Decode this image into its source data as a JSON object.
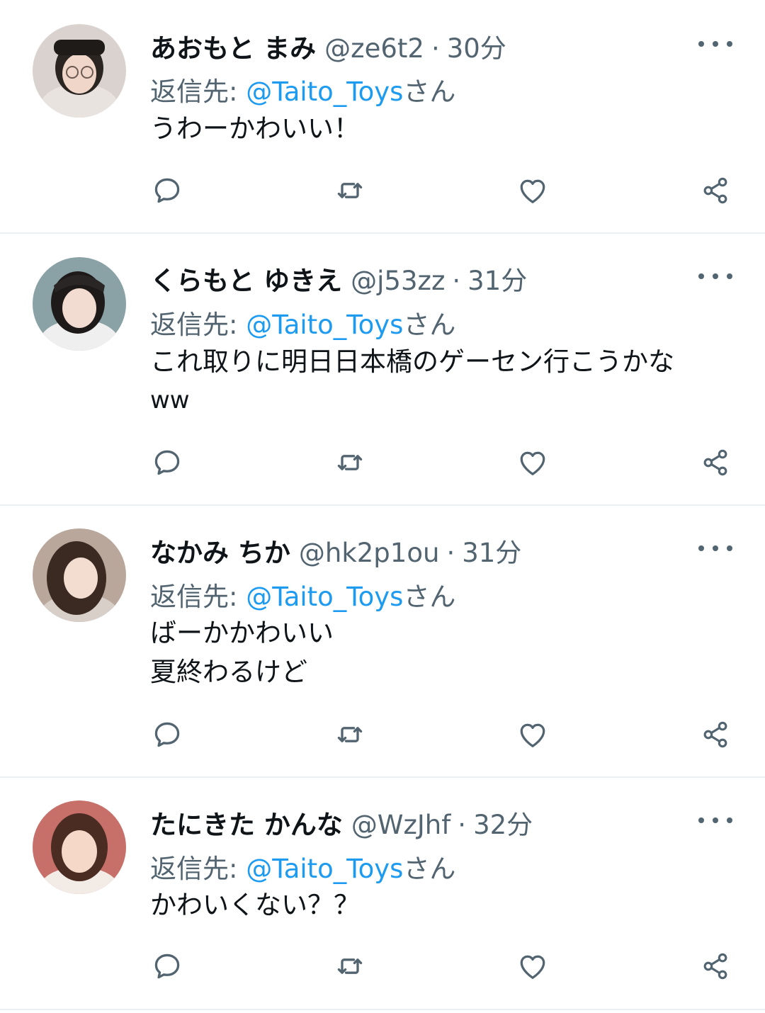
{
  "reply_prefix": "返信先: ",
  "reply_suffix": "さん",
  "separator": "·",
  "tweets": [
    {
      "name": "あおもと まみ",
      "handle": "@ze6t2",
      "time": "30分",
      "mention": "@Taito_Toys",
      "lines": [
        "うわーかわいい！"
      ],
      "avatar": {
        "bg": "#d9d2cf",
        "hair": "#2b2522",
        "skin": "#f0d6c8",
        "cloth": "#e9e3e0"
      }
    },
    {
      "name": "くらもと ゆきえ",
      "handle": "@j53zz",
      "time": "31分",
      "mention": "@Taito_Toys",
      "lines": [
        "これ取りに明日日本橋のゲーセン行こうかな",
        "ww"
      ],
      "avatar": {
        "bg": "#8aa2a6",
        "hair": "#1e1a19",
        "skin": "#f2dbd0",
        "cloth": "#efefef"
      }
    },
    {
      "name": "なかみ ちか",
      "handle": "@hk2p1ou",
      "time": "31分",
      "mention": "@Taito_Toys",
      "lines": [
        "ばーかかわいい",
        "夏終わるけど"
      ],
      "avatar": {
        "bg": "#b9a79c",
        "hair": "#3a2a22",
        "skin": "#f3dcd0",
        "cloth": "#d8cfc8"
      }
    },
    {
      "name": "たにきた かんな",
      "handle": "@WzJhf",
      "time": "32分",
      "mention": "@Taito_Toys",
      "lines": [
        "かわいくない？？"
      ],
      "avatar": {
        "bg": "#c7706a",
        "hair": "#4a2c22",
        "skin": "#f5d8c8",
        "cloth": "#f3ece6"
      }
    }
  ],
  "icons": {
    "reply": "comment-bubble-icon",
    "retweet": "retweet-arrows-icon",
    "like": "heart-outline-icon",
    "share": "share-nodes-icon",
    "more": "three-dots-icon"
  },
  "colors": {
    "text": "#0f1419",
    "secondary": "#536471",
    "link": "#1d9bf0",
    "divider": "#eceff1"
  }
}
